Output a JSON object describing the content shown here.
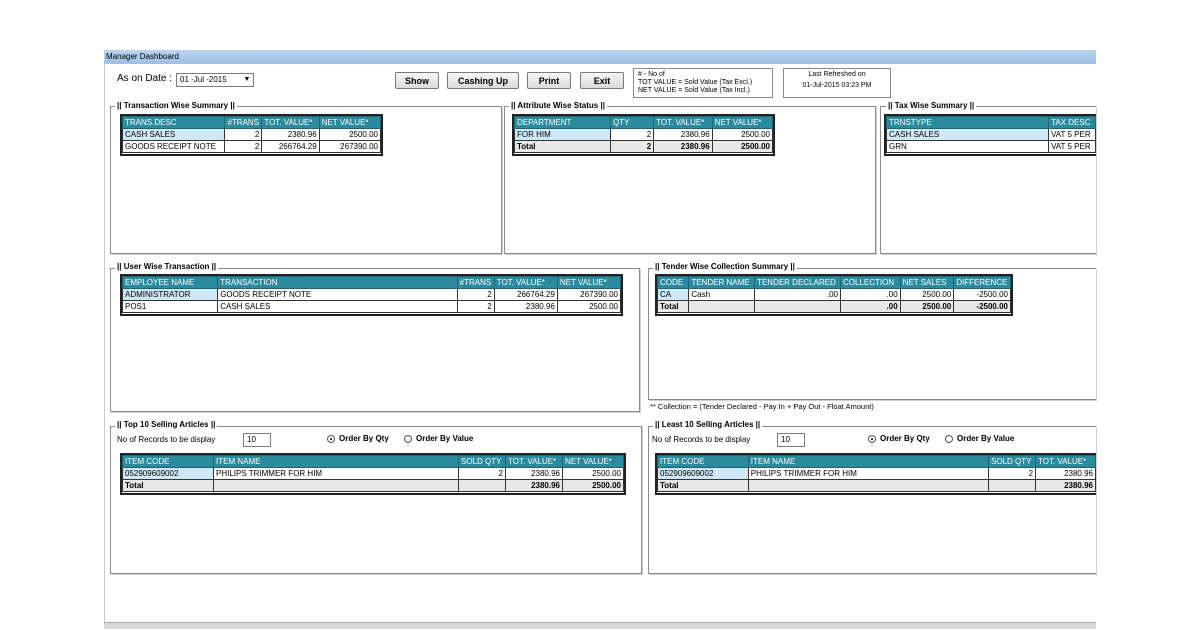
{
  "window": {
    "title": "Manager Dashboard"
  },
  "toolbar": {
    "as_on_date_label": "As on Date :",
    "date_value": "01 -Jul -2015",
    "show_label": "Show",
    "cashing_up_label": "Cashing Up",
    "print_label": "Print",
    "exit_label": "Exit",
    "legend": [
      "# - No of",
      "TOT VALUE = Sold Value (Tax Excl.)",
      "NET VALUE = Sold Value (Tax Incl.)"
    ],
    "last_refreshed_label": "Last Refreshed on",
    "last_refreshed_value": "01-Jul-2015  03:23 PM"
  },
  "transaction_summary": {
    "title": "|| Transaction Wise Summary ||",
    "headers": [
      "TRANS.DESC",
      "#TRANS",
      "TOT. VALUE*",
      "NET VALUE*"
    ],
    "rows": [
      [
        "CASH SALES",
        "2",
        "2380.96",
        "2500.00"
      ],
      [
        "GOODS RECEIPT NOTE",
        "2",
        "266764.29",
        "267390.00"
      ]
    ]
  },
  "attribute_status": {
    "title": "|| Attribute Wise Status ||",
    "headers": [
      "DEPARTMENT",
      "QTY",
      "TOT. VALUE*",
      "NET VALUE*"
    ],
    "rows": [
      [
        "FOR HIM",
        "2",
        "2380.96",
        "2500.00"
      ]
    ],
    "total": [
      "Total",
      "2",
      "2380.96",
      "2500.00"
    ]
  },
  "tax_summary": {
    "title": "|| Tax Wise Summary ||",
    "headers": [
      "TRNSTYPE",
      "TAX DESC"
    ],
    "rows": [
      [
        "CASH SALES",
        "VAT 5 PER"
      ],
      [
        "GRN",
        "VAT 5 PER"
      ]
    ]
  },
  "user_transaction": {
    "title": "|| User Wise Transaction ||",
    "headers": [
      "EMPLOYEE NAME",
      "TRANSACTION",
      "#TRANS",
      "TOT. VALUE*",
      "NET VALUE*"
    ],
    "rows": [
      [
        "ADMINISTRATOR",
        "GOODS RECEIPT NOTE",
        "2",
        "266764.29",
        "267390.00"
      ],
      [
        "POS1",
        "CASH SALES",
        "2",
        "2380.96",
        "2500.00"
      ]
    ]
  },
  "tender_summary": {
    "title": "|| Tender Wise Collection Summary ||",
    "headers": [
      "CODE",
      "TENDER NAME",
      "TENDER DECLARED",
      "COLLECTION",
      "NET SALES",
      "DIFFERENCE"
    ],
    "rows": [
      [
        "CA",
        "Cash",
        ".00",
        ".00",
        "2500.00",
        "-2500.00"
      ]
    ],
    "total": [
      "Total",
      "",
      "",
      ".00",
      "2500.00",
      "-2500.00"
    ],
    "note": "** Collection = (Tender Declared - Pay In + Pay Out - Float Amount)"
  },
  "top10": {
    "title": "|| Top 10 Selling Articles ||",
    "records_label": "No of Records to be display",
    "records_value": "10",
    "order_qty_label": "Order By Qty",
    "order_value_label": "Order By Value",
    "headers": [
      "ITEM CODE",
      "ITEM NAME",
      "SOLD QTY",
      "TOT. VALUE*",
      "NET VALUE*"
    ],
    "rows": [
      [
        "052909609002",
        "PHILIPS TRIMMER FOR HIM",
        "2",
        "2380.96",
        "2500.00"
      ]
    ],
    "total": [
      "Total",
      "",
      "",
      "2380.96",
      "2500.00"
    ]
  },
  "least10": {
    "title": "|| Least 10 Selling Articles ||",
    "records_label": "No of Records to be display",
    "records_value": "10",
    "order_qty_label": "Order By Qty",
    "order_value_label": "Order By Value",
    "headers": [
      "ITEM CODE",
      "ITEM NAME",
      "SOLD QTY",
      "TOT. VALUE*"
    ],
    "rows": [
      [
        "052909609002",
        "PHILIPS TRIMMER FOR HIM",
        "2",
        "2380.96"
      ]
    ],
    "total": [
      "Total",
      "",
      "",
      "2380.96"
    ]
  },
  "colors": {
    "header": "#2b8a9e",
    "selected": "#cfe8f5",
    "titlebar": "#9ec0e6"
  }
}
